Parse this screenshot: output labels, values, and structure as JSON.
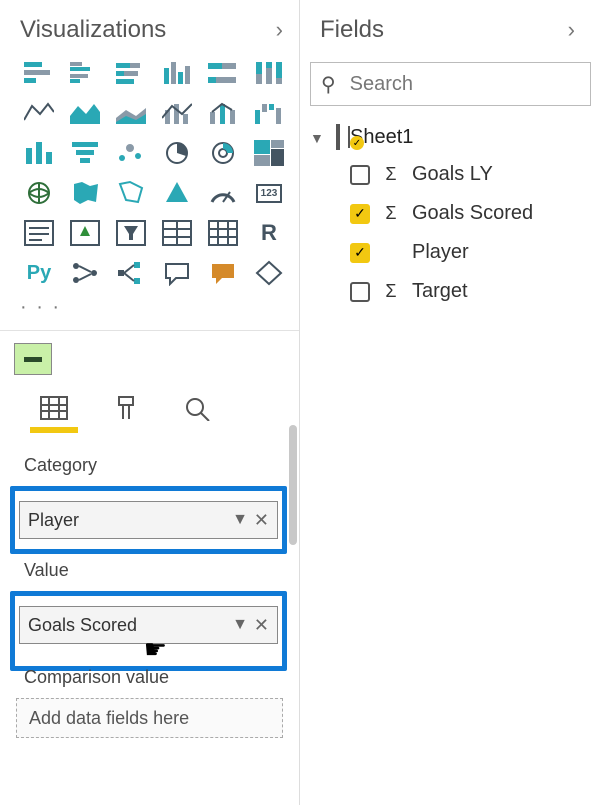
{
  "visualizations": {
    "title": "Visualizations",
    "wells": {
      "category": {
        "label": "Category",
        "field": "Player"
      },
      "value": {
        "label": "Value",
        "field": "Goals Scored"
      },
      "comparison": {
        "label": "Comparison value",
        "placeholder": "Add data fields here"
      }
    }
  },
  "fields": {
    "title": "Fields",
    "search_placeholder": "Search",
    "table": {
      "name": "Sheet1"
    },
    "items": [
      {
        "name": "Goals LY",
        "checked": false,
        "aggregate": true
      },
      {
        "name": "Goals Scored",
        "checked": true,
        "aggregate": true
      },
      {
        "name": "Player",
        "checked": true,
        "aggregate": false
      },
      {
        "name": "Target",
        "checked": false,
        "aggregate": true
      }
    ]
  }
}
